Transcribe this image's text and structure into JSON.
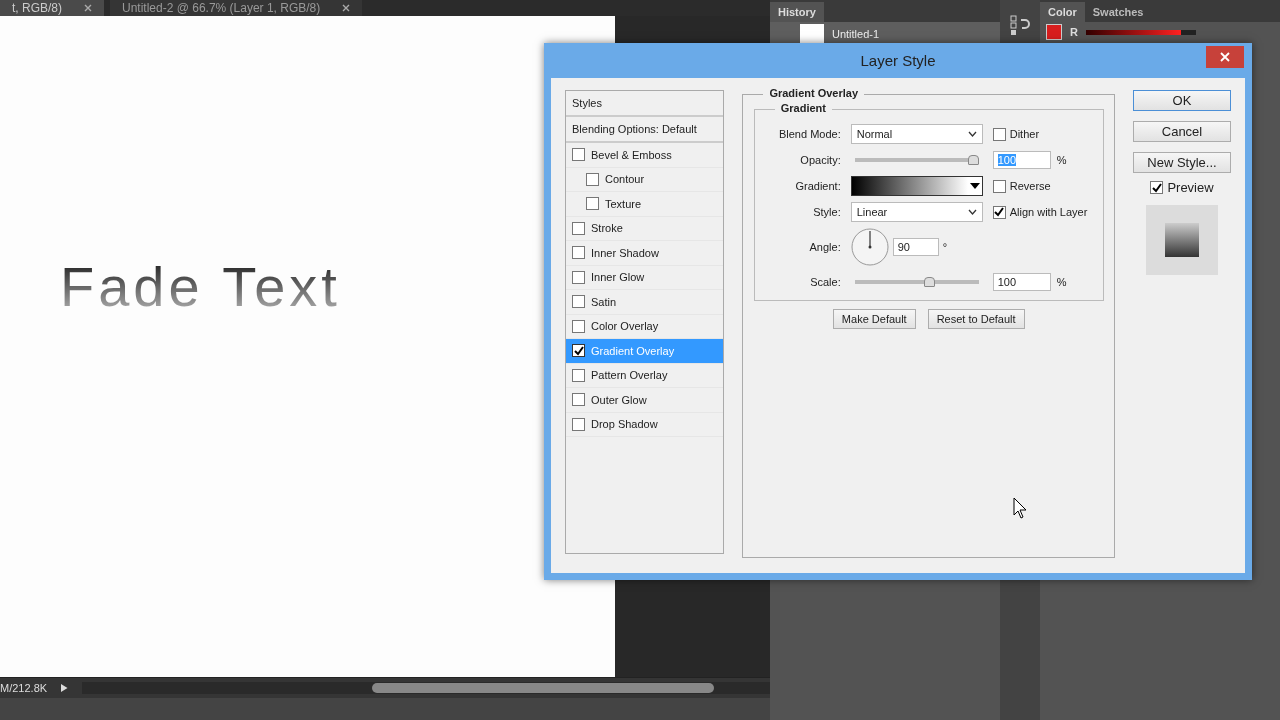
{
  "doc_tabs": [
    {
      "label": "t, RGB/8)",
      "selected": true
    },
    {
      "label": "Untitled-2 @ 66.7% (Layer 1, RGB/8)",
      "selected": false
    }
  ],
  "canvas_text": "Fade Text",
  "history": {
    "title": "History",
    "items": [
      {
        "label": "Untitled-1"
      }
    ]
  },
  "color_panel": {
    "tabs": [
      {
        "label": "Color",
        "selected": true
      },
      {
        "label": "Swatches",
        "selected": false
      }
    ],
    "channel": "R",
    "level": 0.86
  },
  "status": "M/212.8K",
  "dialog": {
    "title": "Layer Style",
    "styles": [
      {
        "label": "Styles",
        "kind": "header",
        "selected": false
      },
      {
        "label": "Blending Options: Default",
        "kind": "header",
        "selected": false
      },
      {
        "label": "Bevel & Emboss",
        "kind": "check",
        "checked": false,
        "selected": false,
        "children": [
          {
            "label": "Contour",
            "kind": "check",
            "checked": false,
            "selected": false
          },
          {
            "label": "Texture",
            "kind": "check",
            "checked": false,
            "selected": false
          }
        ]
      },
      {
        "label": "Stroke",
        "kind": "check",
        "checked": false,
        "selected": false
      },
      {
        "label": "Inner Shadow",
        "kind": "check",
        "checked": false,
        "selected": false
      },
      {
        "label": "Inner Glow",
        "kind": "check",
        "checked": false,
        "selected": false
      },
      {
        "label": "Satin",
        "kind": "check",
        "checked": false,
        "selected": false
      },
      {
        "label": "Color Overlay",
        "kind": "check",
        "checked": false,
        "selected": false
      },
      {
        "label": "Gradient Overlay",
        "kind": "check",
        "checked": true,
        "selected": true
      },
      {
        "label": "Pattern Overlay",
        "kind": "check",
        "checked": false,
        "selected": false
      },
      {
        "label": "Outer Glow",
        "kind": "check",
        "checked": false,
        "selected": false
      },
      {
        "label": "Drop Shadow",
        "kind": "check",
        "checked": false,
        "selected": false
      }
    ],
    "section_title": "Gradient Overlay",
    "group_title": "Gradient",
    "blend_mode": {
      "label": "Blend Mode:",
      "value": "Normal"
    },
    "dither": {
      "label": "Dither",
      "checked": false
    },
    "opacity": {
      "label": "Opacity:",
      "level": 1.0,
      "value": "100",
      "unit": "%"
    },
    "gradient": {
      "label": "Gradient:"
    },
    "reverse": {
      "label": "Reverse",
      "checked": false
    },
    "style": {
      "label": "Style:",
      "value": "Linear"
    },
    "align": {
      "label": "Align with Layer",
      "checked": true
    },
    "angle": {
      "label": "Angle:",
      "value": "90",
      "unit": "°"
    },
    "scale": {
      "label": "Scale:",
      "level": 0.61,
      "value": "100",
      "unit": "%"
    },
    "section_buttons": [
      "Make Default",
      "Reset to Default"
    ],
    "buttons": [
      {
        "label": "OK",
        "kind": "default"
      },
      {
        "label": "Cancel",
        "kind": "plain"
      },
      {
        "label": "New Style...",
        "kind": "plain"
      }
    ],
    "preview": {
      "label": "Preview",
      "checked": true
    }
  }
}
